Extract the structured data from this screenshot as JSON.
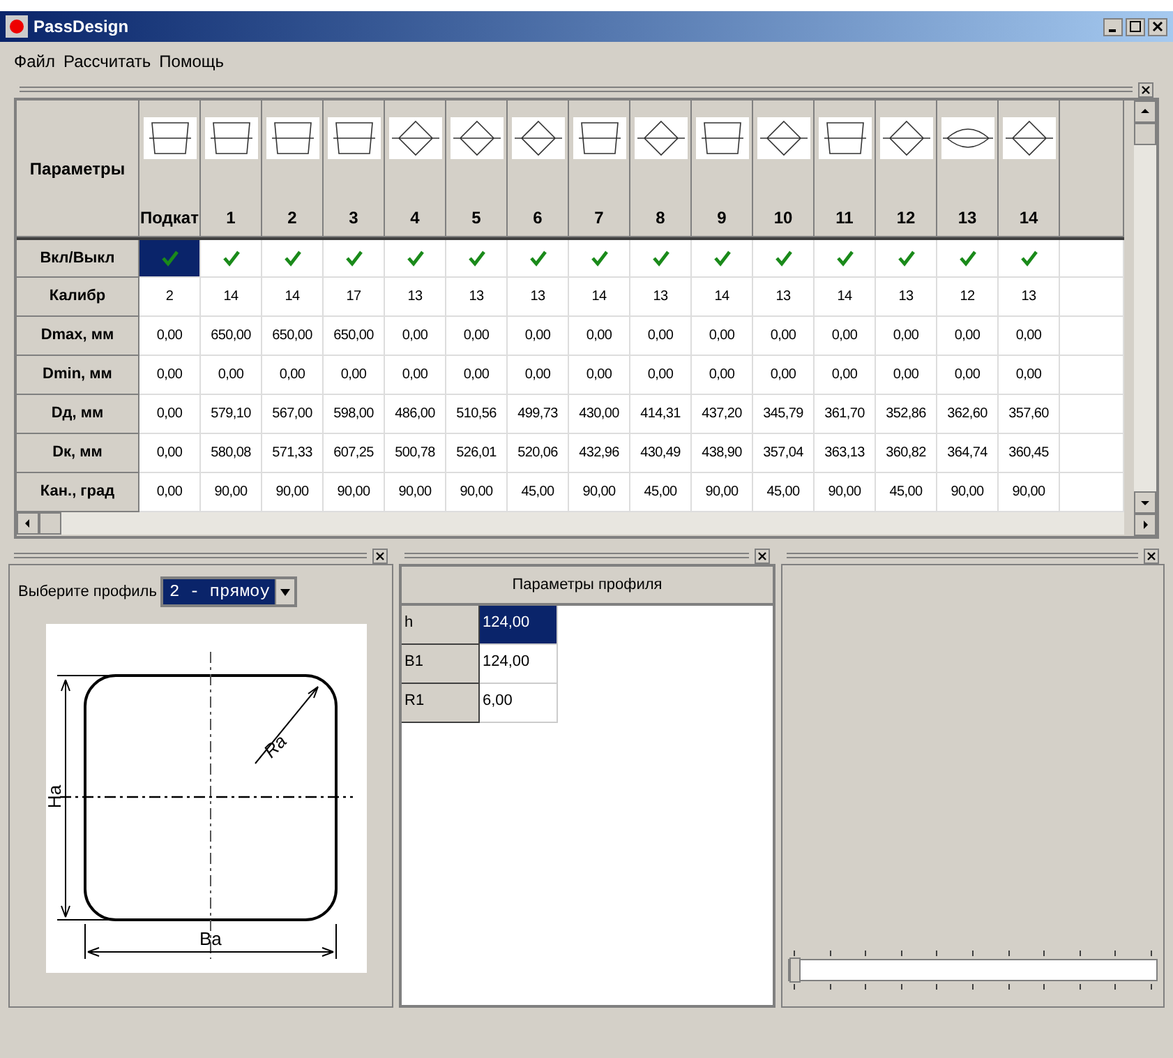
{
  "window": {
    "title": "PassDesign"
  },
  "menu": [
    "Файл",
    "Рассчитать",
    "Помощь"
  ],
  "grid": {
    "corner": "Параметры",
    "columns": [
      {
        "label": "Подкат",
        "kind": "box",
        "checked": true,
        "selected": true
      },
      {
        "label": "1",
        "kind": "box",
        "checked": true,
        "selected": false
      },
      {
        "label": "2",
        "kind": "box",
        "checked": true,
        "selected": false
      },
      {
        "label": "3",
        "kind": "box",
        "checked": true,
        "selected": false
      },
      {
        "label": "4",
        "kind": "diamond",
        "checked": true,
        "selected": false
      },
      {
        "label": "5",
        "kind": "diamond",
        "checked": true,
        "selected": false
      },
      {
        "label": "6",
        "kind": "diamond",
        "checked": true,
        "selected": false
      },
      {
        "label": "7",
        "kind": "box",
        "checked": true,
        "selected": false
      },
      {
        "label": "8",
        "kind": "diamond",
        "checked": true,
        "selected": false
      },
      {
        "label": "9",
        "kind": "box",
        "checked": true,
        "selected": false
      },
      {
        "label": "10",
        "kind": "diamond",
        "checked": true,
        "selected": false
      },
      {
        "label": "11",
        "kind": "box",
        "checked": true,
        "selected": false
      },
      {
        "label": "12",
        "kind": "diamond",
        "checked": true,
        "selected": false
      },
      {
        "label": "13",
        "kind": "oval",
        "checked": true,
        "selected": false
      },
      {
        "label": "14",
        "kind": "diamond",
        "checked": true,
        "selected": false
      }
    ],
    "toggle_label": "Вкл/Выкл",
    "rows": [
      {
        "label": "Калибр",
        "values": [
          "2",
          "14",
          "14",
          "17",
          "13",
          "13",
          "13",
          "14",
          "13",
          "14",
          "13",
          "14",
          "13",
          "12",
          "13"
        ]
      },
      {
        "label": "Dmax, мм",
        "values": [
          "0,00",
          "650,00",
          "650,00",
          "650,00",
          "0,00",
          "0,00",
          "0,00",
          "0,00",
          "0,00",
          "0,00",
          "0,00",
          "0,00",
          "0,00",
          "0,00",
          "0,00"
        ]
      },
      {
        "label": "Dmin, мм",
        "values": [
          "0,00",
          "0,00",
          "0,00",
          "0,00",
          "0,00",
          "0,00",
          "0,00",
          "0,00",
          "0,00",
          "0,00",
          "0,00",
          "0,00",
          "0,00",
          "0,00",
          "0,00"
        ]
      },
      {
        "label": "Dд, мм",
        "values": [
          "0,00",
          "579,10",
          "567,00",
          "598,00",
          "486,00",
          "510,56",
          "499,73",
          "430,00",
          "414,31",
          "437,20",
          "345,79",
          "361,70",
          "352,86",
          "362,60",
          "357,60"
        ]
      },
      {
        "label": "Dк, мм",
        "values": [
          "0,00",
          "580,08",
          "571,33",
          "607,25",
          "500,78",
          "526,01",
          "520,06",
          "432,96",
          "430,49",
          "438,90",
          "357,04",
          "363,13",
          "360,82",
          "364,74",
          "360,45"
        ]
      },
      {
        "label": "Кан., град",
        "values": [
          "0,00",
          "90,00",
          "90,00",
          "90,00",
          "90,00",
          "90,00",
          "45,00",
          "90,00",
          "45,00",
          "90,00",
          "45,00",
          "90,00",
          "45,00",
          "90,00",
          "90,00"
        ]
      }
    ]
  },
  "profile_panel": {
    "label": "Выберите профиль",
    "value": "2 - прямоу",
    "drawing_labels": {
      "radius": "Ra",
      "height": "Ha",
      "width": "Ba"
    }
  },
  "params_panel": {
    "title": "Параметры профиля",
    "rows": [
      {
        "name": "h",
        "value": "124,00",
        "selected": true
      },
      {
        "name": "B1",
        "value": "124,00",
        "selected": false
      },
      {
        "name": "R1",
        "value": "6,00",
        "selected": false
      }
    ]
  },
  "slider": {
    "level": 0
  }
}
